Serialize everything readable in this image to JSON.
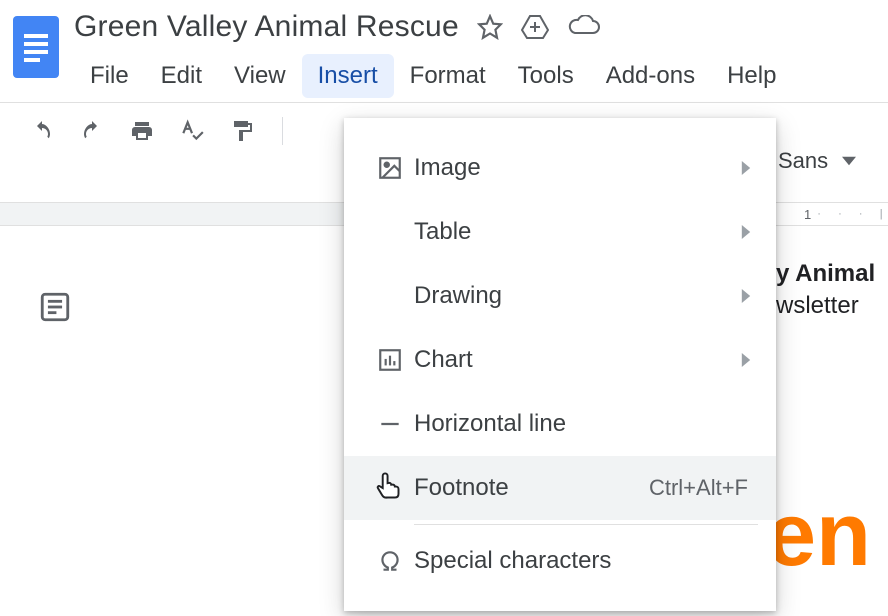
{
  "doc": {
    "title": "Green Valley Animal Rescue"
  },
  "menus": {
    "file": "File",
    "edit": "Edit",
    "view": "View",
    "insert": "Insert",
    "format": "Format",
    "tools": "Tools",
    "addons": "Add-ons",
    "help": "Help"
  },
  "toolbar": {
    "font_name": "Sans"
  },
  "ruler": {
    "mark": "1"
  },
  "content": {
    "line1": "y Animal",
    "line2": "wsletter",
    "big": "en"
  },
  "insert_menu": {
    "image": "Image",
    "table": "Table",
    "drawing": "Drawing",
    "chart": "Chart",
    "hline": "Horizontal line",
    "footnote": "Footnote",
    "footnote_shortcut": "Ctrl+Alt+F",
    "special": "Special characters"
  }
}
